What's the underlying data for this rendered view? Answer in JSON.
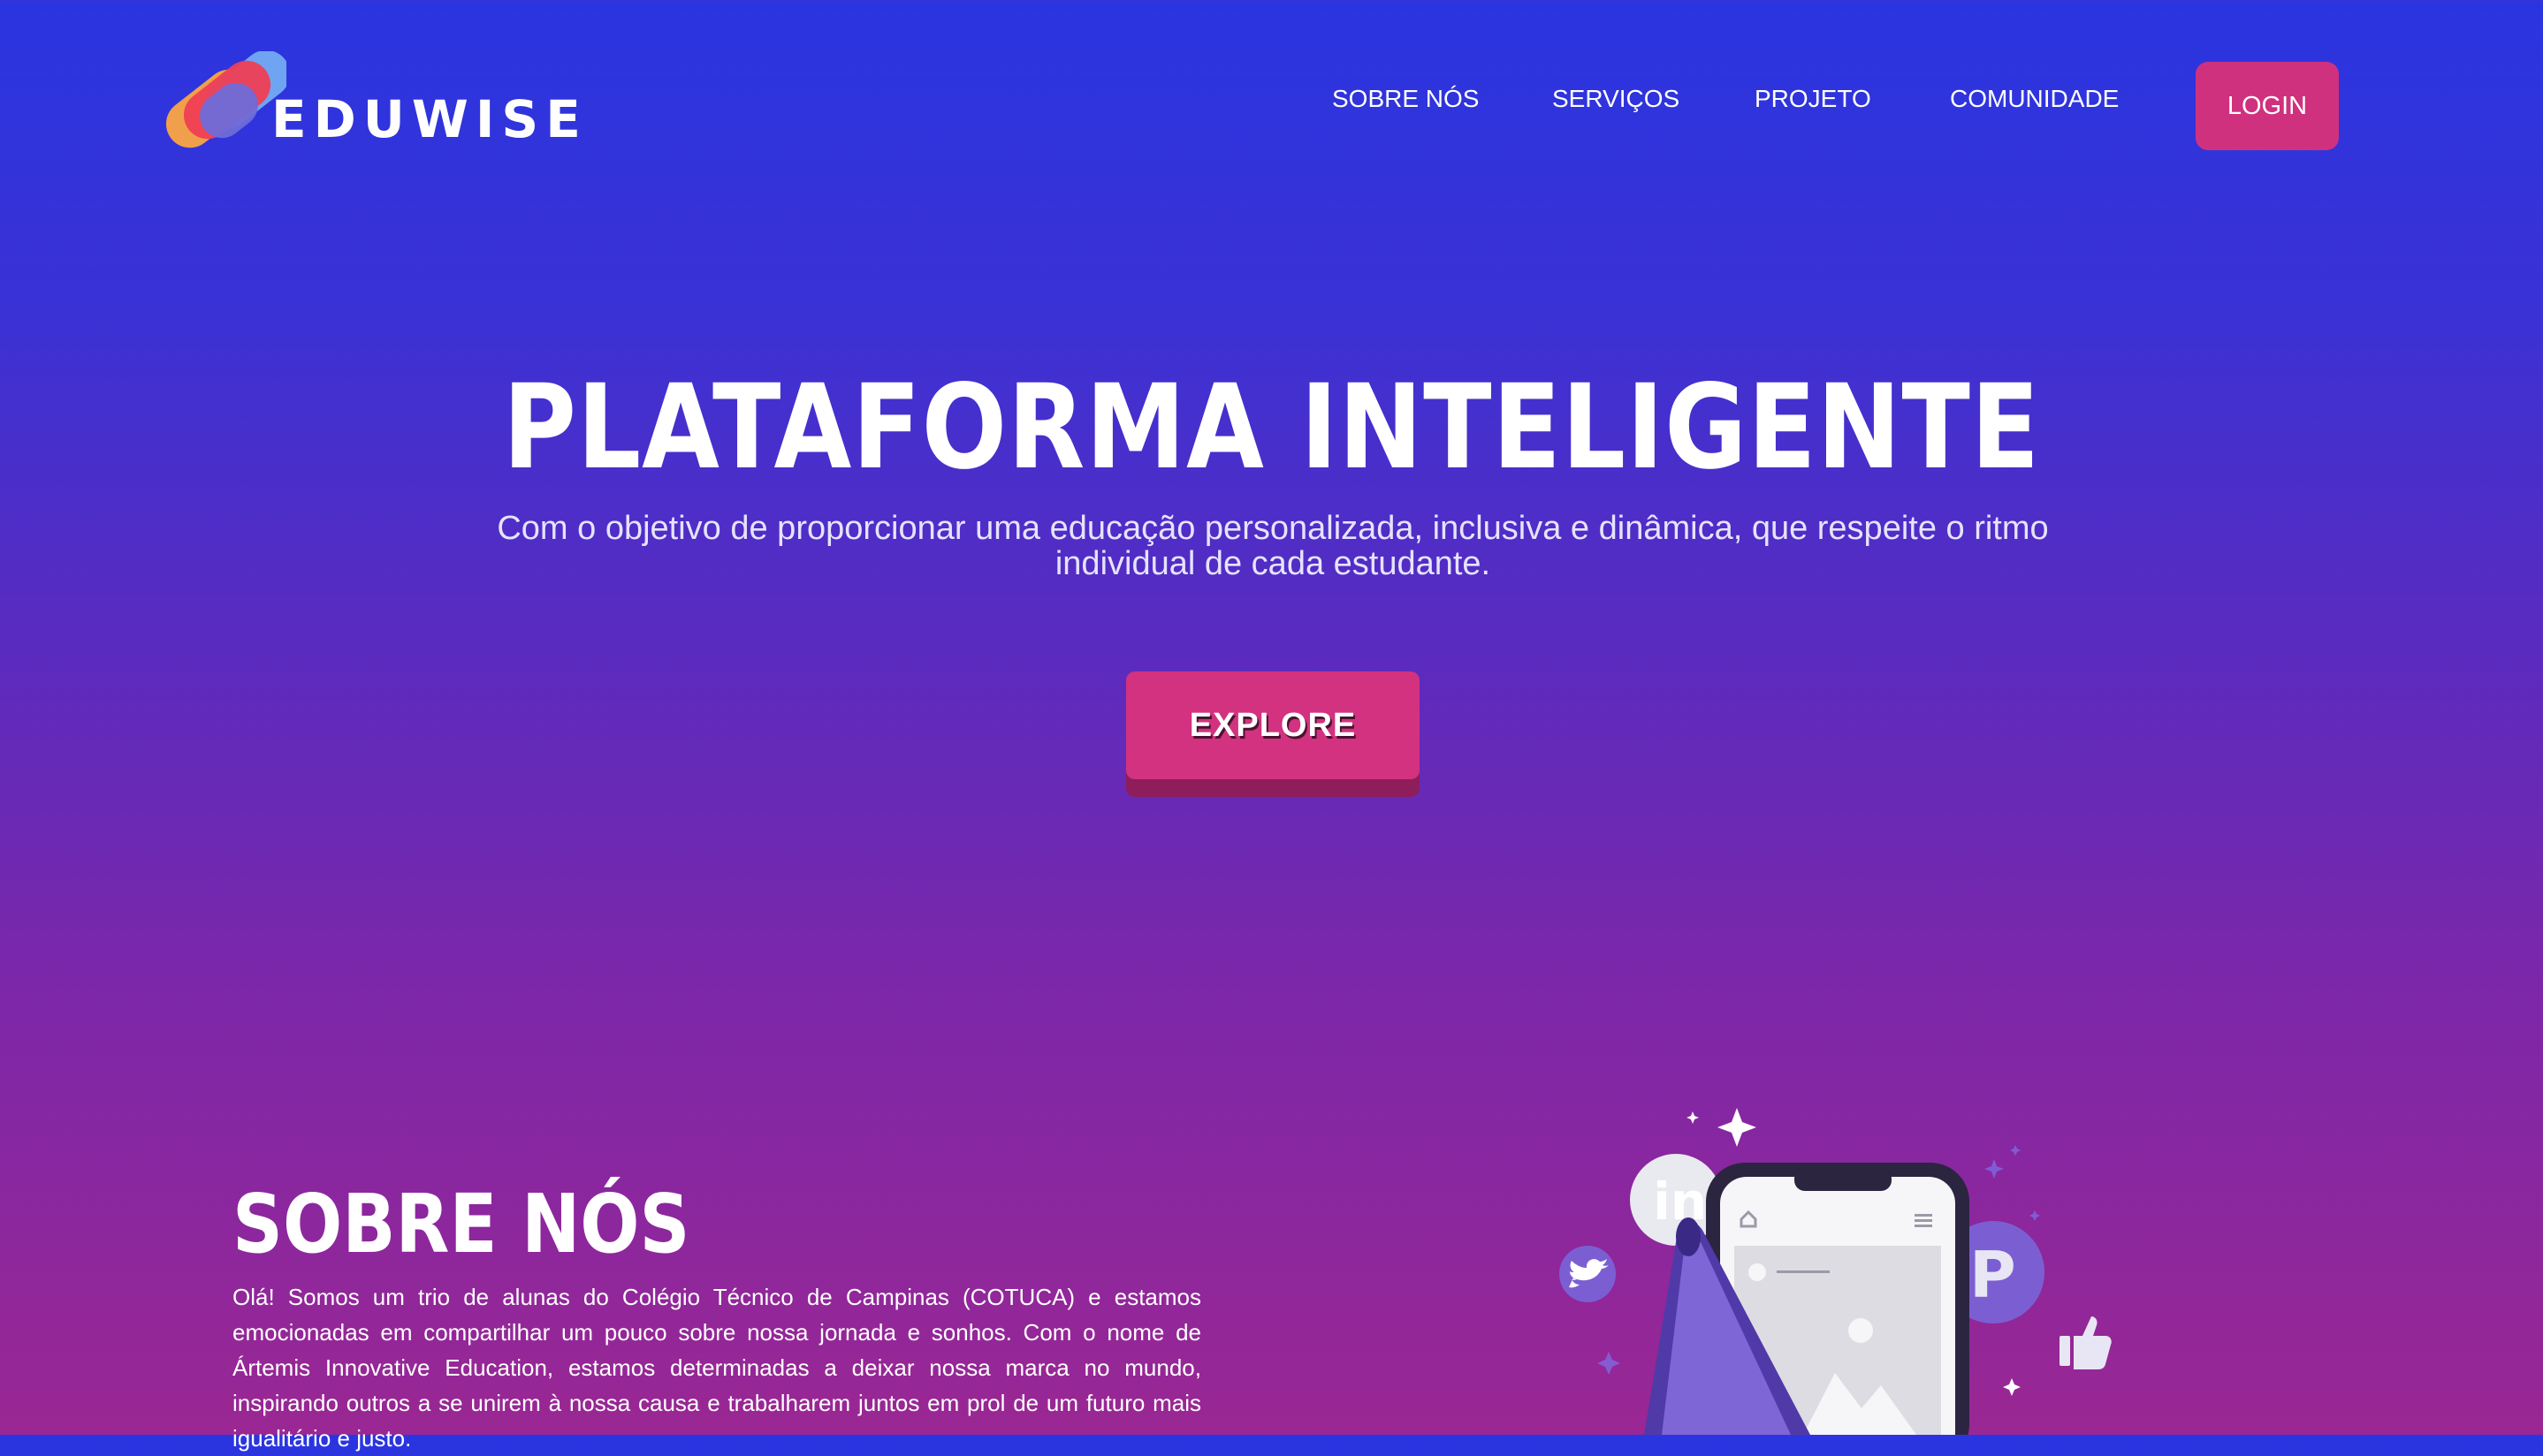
{
  "brand": {
    "name": "EDUWISE",
    "colors": {
      "logo_red": "#ef3f55",
      "logo_orange": "#f0a04b",
      "logo_blue": "#6fa4f2",
      "logo_purple": "#6f6bd8"
    }
  },
  "nav": {
    "items": [
      "SOBRE NÓS",
      "SERVIÇOS",
      "PROJETO",
      "COMUNIDADE"
    ],
    "login_label": "LOGIN"
  },
  "hero": {
    "title": "PLATAFORMA INTELIGENTE",
    "subtitle": "Com o objetivo de proporcionar uma educação personalizada, inclusiva e dinâmica, que respeite o ritmo individual de cada estudante.",
    "cta_label": "EXPLORE"
  },
  "about": {
    "title": "SOBRE NÓS",
    "text": "Olá! Somos um trio de alunas do Colégio Técnico de Campinas (COTUCA) e estamos emocionadas em compartilhar um pouco sobre nossa jornada e sonhos. Com o nome de Ártemis Innovative Education, estamos determinadas a deixar nossa marca no mundo, inspirando outros a se unirem à nossa causa e trabalharem juntos em prol de um futuro mais igualitário e justo."
  },
  "illustration": {
    "icons": [
      "linkedin-icon",
      "twitter-icon",
      "pinterest-icon",
      "thumbs-up-icon",
      "megaphone-icon",
      "phone-icon"
    ]
  },
  "theme": {
    "accent": "#d0317e",
    "gradient_top": "#2a35e0",
    "gradient_bottom": "#9a2793"
  }
}
